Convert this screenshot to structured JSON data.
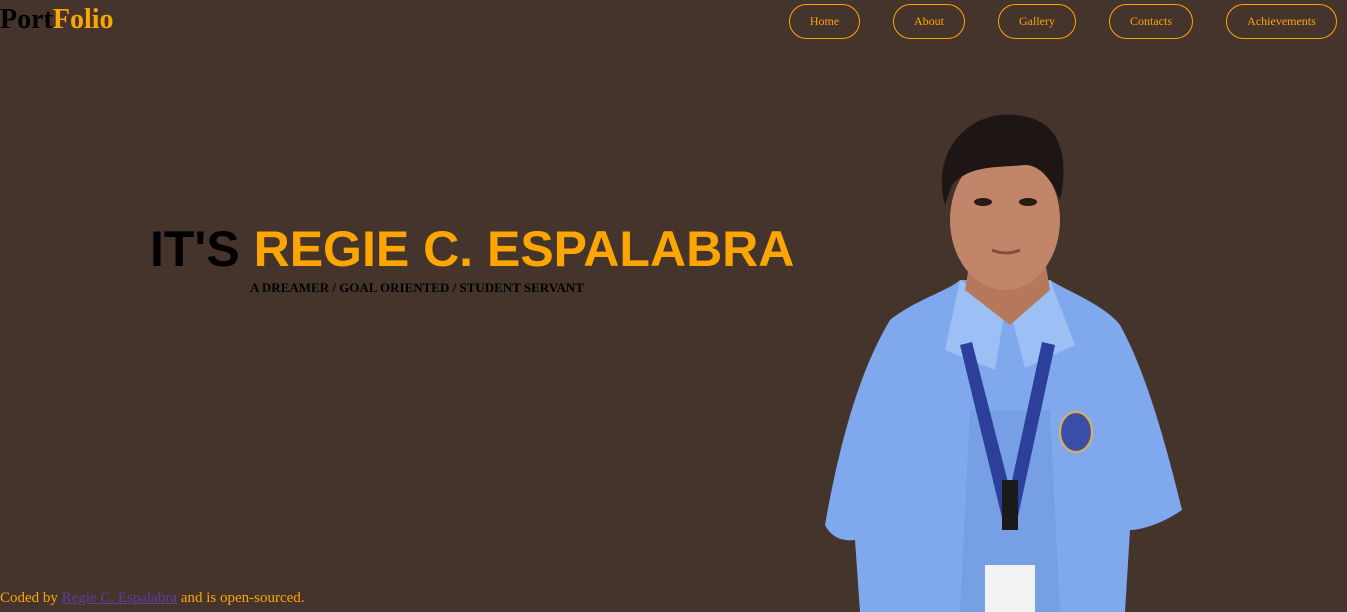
{
  "logo": {
    "part1": "Port",
    "part2": "Folio"
  },
  "nav": {
    "items": [
      {
        "label": "Home"
      },
      {
        "label": "About"
      },
      {
        "label": "Gallery"
      },
      {
        "label": "Contacts"
      },
      {
        "label": "Achievements"
      }
    ]
  },
  "hero": {
    "prefix": "IT'S",
    "name": "REGIE C. ESPALABRA",
    "tagline": "A DREAMER / GOAL ORIENTED / STUDENT SERVANT"
  },
  "footer": {
    "prefix": "Coded by",
    "link_text": "Regie C. Espalabra",
    "suffix": "and is open-sourced."
  },
  "colors": {
    "background": "#45342c",
    "accent": "#ffa500",
    "link": "#5b3fa0"
  }
}
